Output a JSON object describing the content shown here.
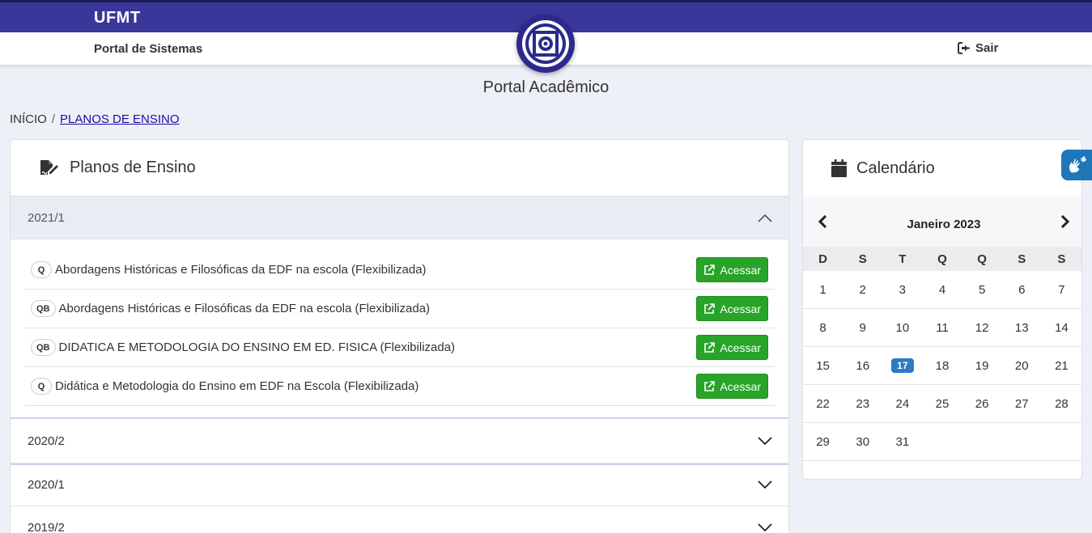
{
  "header": {
    "brand": "UFMT",
    "portal_link": "Portal de Sistemas",
    "logout_label": "Sair",
    "app_title": "Portal Acadêmico"
  },
  "breadcrumb": {
    "home": "INÍCIO",
    "separator": "/",
    "current": "PLANOS DE ENSINO"
  },
  "planos": {
    "title": "Planos de Ensino",
    "open_period": "2021/1",
    "courses": [
      {
        "badge": "Q",
        "name": "Abordagens Históricas e Filosóficas da EDF na escola (Flexibilizada)",
        "button": "Acessar"
      },
      {
        "badge": "QB",
        "name": "Abordagens Históricas e Filosóficas da EDF na escola (Flexibilizada)",
        "button": "Acessar"
      },
      {
        "badge": "QB",
        "name": "DIDATICA E METODOLOGIA DO ENSINO EM ED. FISICA (Flexibilizada)",
        "button": "Acessar"
      },
      {
        "badge": "Q",
        "name": "Didática e Metodologia do Ensino em EDF na Escola (Flexibilizada)",
        "button": "Acessar"
      }
    ],
    "closed_periods": [
      "2020/2",
      "2020/1",
      "2019/2"
    ]
  },
  "calendar": {
    "title": "Calendário",
    "month": "Janeiro 2023",
    "weekdays": [
      "D",
      "S",
      "T",
      "Q",
      "Q",
      "S",
      "S"
    ],
    "days": [
      "1",
      "2",
      "3",
      "4",
      "5",
      "6",
      "7",
      "8",
      "9",
      "10",
      "11",
      "12",
      "13",
      "14",
      "15",
      "16",
      "17",
      "18",
      "19",
      "20",
      "21",
      "22",
      "23",
      "24",
      "25",
      "26",
      "27",
      "28",
      "29",
      "30",
      "31"
    ],
    "today": "17"
  },
  "colors": {
    "topbar": "#3a379a",
    "accent_green": "#28a428",
    "today_blue": "#2f79c4",
    "link": "#1a0dab"
  }
}
